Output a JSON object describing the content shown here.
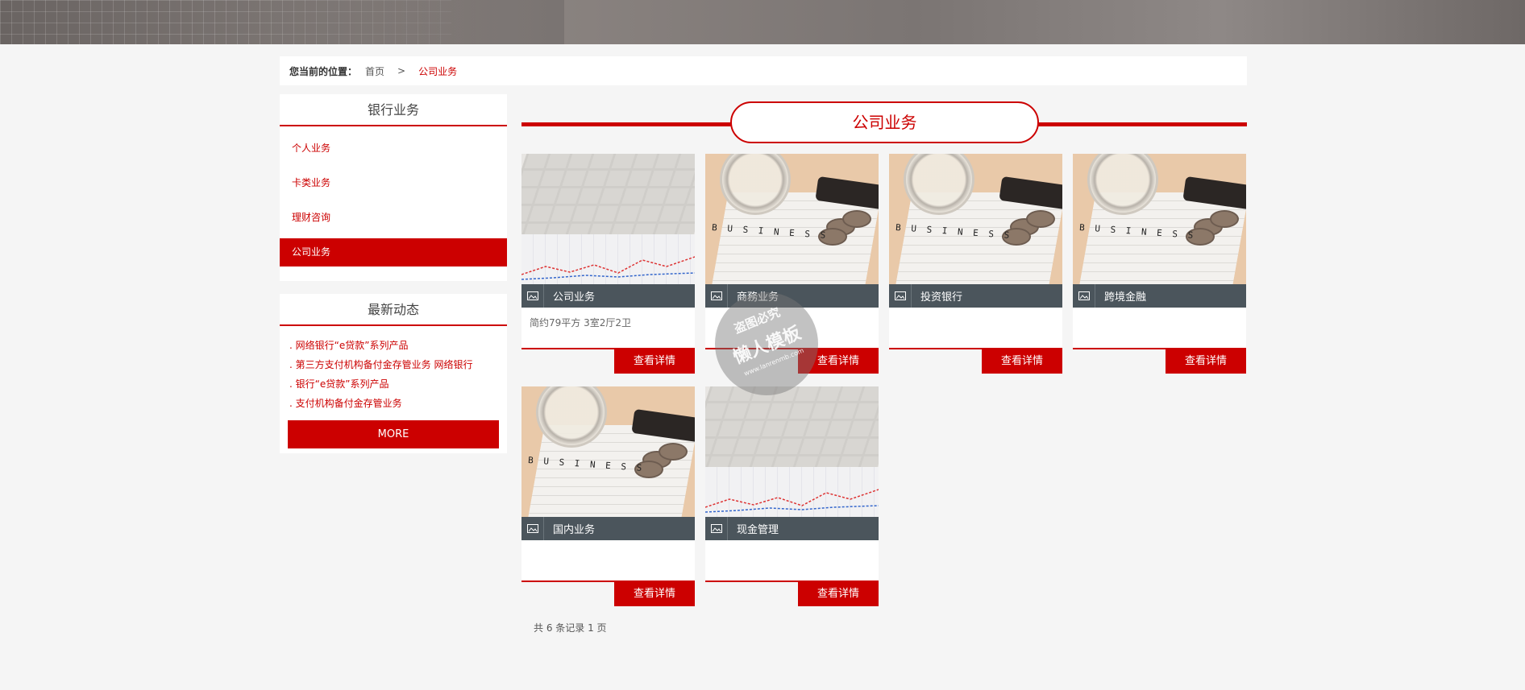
{
  "breadcrumb": {
    "label": "您当前的位置：",
    "home": "首页",
    "separator": ">",
    "current": "公司业务"
  },
  "sidebar": {
    "menu_title": "银行业务",
    "items": [
      {
        "label": "个人业务",
        "active": false
      },
      {
        "label": "卡类业务",
        "active": false
      },
      {
        "label": "理财咨询",
        "active": false
      },
      {
        "label": "公司业务",
        "active": true
      }
    ],
    "news_title": "最新动态",
    "news": [
      ". 网络银行“e贷款”系列产品",
      ". 第三方支付机构备付金存管业务 网络银行",
      ". 银行“e贷款”系列产品",
      ". 支付机构备付金存管业务"
    ],
    "more_label": "MORE"
  },
  "section": {
    "title": "公司业务"
  },
  "cards": [
    {
      "title": "公司业务",
      "desc": "简约79平方 3室2厅2卫",
      "button": "查看详情",
      "image": "keyboard"
    },
    {
      "title": "商務业务",
      "desc": "",
      "button": "查看详情",
      "image": "magnifier"
    },
    {
      "title": "投资银行",
      "desc": "",
      "button": "查看详情",
      "image": "magnifier"
    },
    {
      "title": "跨境金融",
      "desc": "",
      "button": "查看详情",
      "image": "magnifier"
    },
    {
      "title": "国内业务",
      "desc": "",
      "button": "查看详情",
      "image": "magnifier"
    },
    {
      "title": "现金管理",
      "desc": "",
      "button": "查看详情",
      "image": "keyboard"
    }
  ],
  "pager": {
    "text": "共 6 条记录 1 页"
  },
  "watermark": {
    "line1": "盗图必究",
    "line2": "懒人模板",
    "line3": "www.lanrenmb.com"
  },
  "colors": {
    "accent": "#cc0000",
    "caption_bg": "#4b555c",
    "page_bg": "#f5f5f5"
  }
}
